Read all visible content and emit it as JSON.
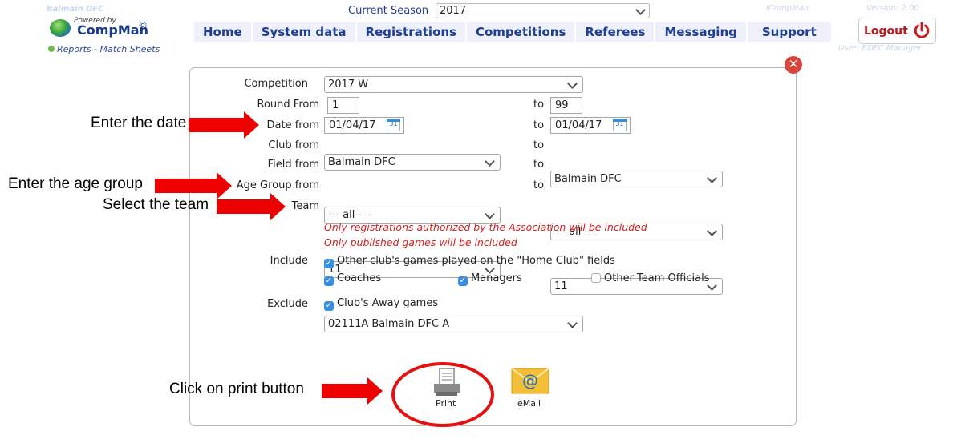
{
  "header": {
    "club": "Balmain DFC",
    "powered_by": "Powered by",
    "brand": "CompMan",
    "copyright": "©",
    "breadcrumb": "Reports - Match Sheets",
    "season_label": "Current Season",
    "season_value": "2017",
    "app_name": "iCompMan",
    "version": "Version: 2.00",
    "user": "User: BDFC Manager",
    "logout_label": "Logout"
  },
  "nav": {
    "home": "Home",
    "system_data": "System data",
    "registrations": "Registrations",
    "competitions": "Competitions",
    "referees": "Referees",
    "messaging": "Messaging",
    "support": "Support"
  },
  "form": {
    "competition": {
      "label": "Competition",
      "value": "2017 W"
    },
    "round": {
      "label": "Round From",
      "from": "1",
      "to": "99"
    },
    "date": {
      "label": "Date from",
      "from": "01/04/17",
      "to": "01/04/17",
      "calendar_day": "31"
    },
    "club": {
      "label": "Club from",
      "from": "Balmain DFC",
      "to": "Balmain DFC"
    },
    "field": {
      "label": "Field from",
      "from": "--- all ---",
      "to": "--- all ---"
    },
    "age_group": {
      "label": "Age Group from",
      "from": "11",
      "to": "11"
    },
    "team": {
      "label": "Team",
      "value": "02111A Balmain DFC A"
    },
    "to_label": "to",
    "note1": "Only registrations authorized by the Association will be included",
    "note2": "Only published games will be included",
    "include_label": "Include",
    "include_home_fields": "Other club's games played on the \"Home Club\" fields",
    "coaches": "Coaches",
    "managers": "Managers",
    "other_officials": "Other Team Officials",
    "exclude_label": "Exclude",
    "away_games": "Club's Away games"
  },
  "actions": {
    "print": "Print",
    "email": "eMail",
    "close_symbol": "✕"
  },
  "annotations": {
    "date": "Enter the date",
    "age_group": "Enter the age group",
    "team": "Select the team",
    "print": "Click on print button"
  },
  "colors": {
    "nav_text": "#1f3f95",
    "nav_bg": "#eef1fa",
    "annotation_red": "#ec0000",
    "note_red": "#d42020",
    "checkbox_blue": "#3b8fe0"
  }
}
